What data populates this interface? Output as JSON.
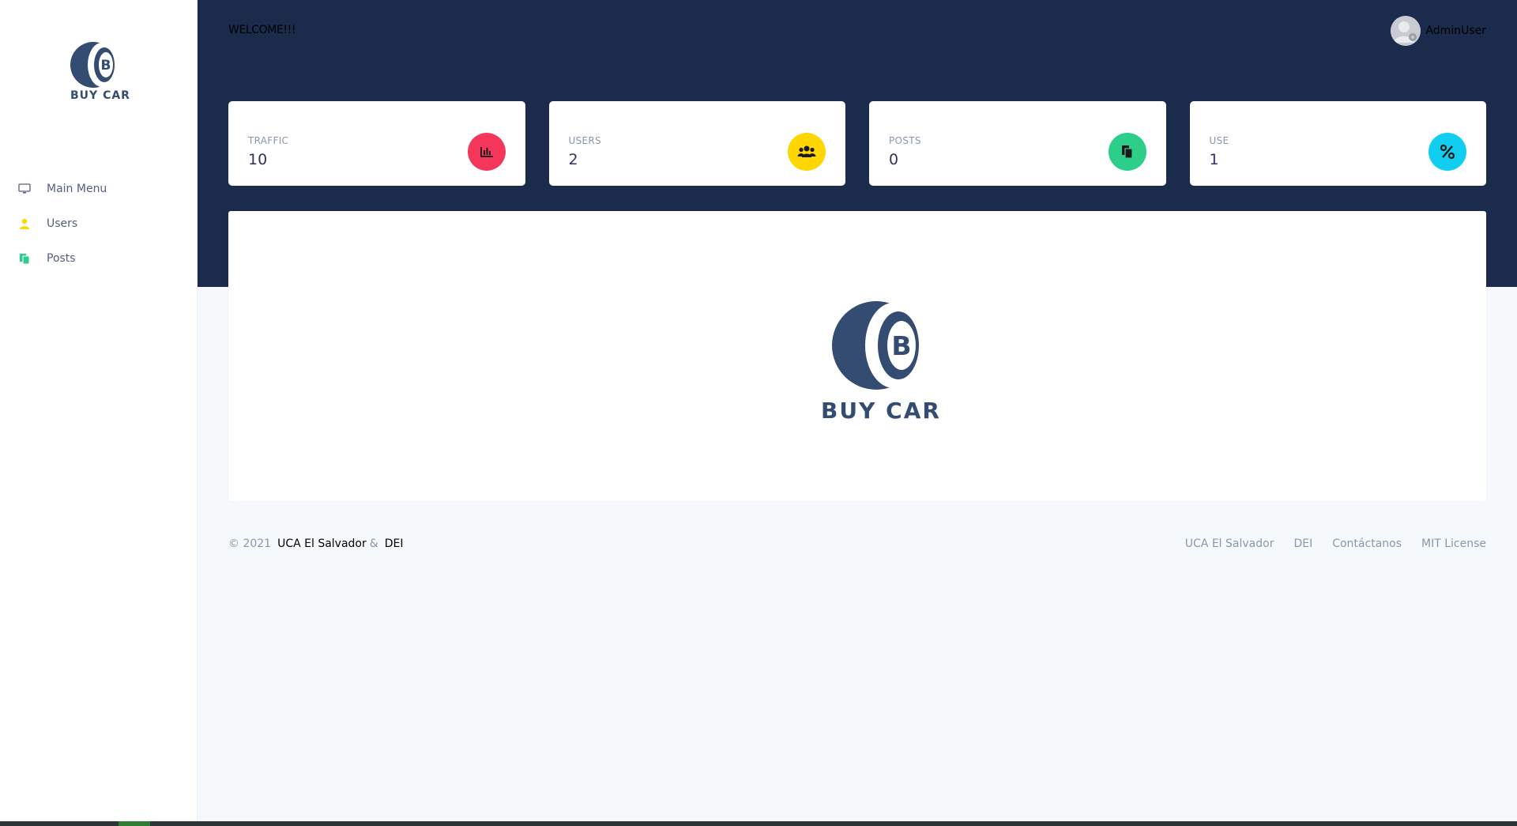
{
  "brand": {
    "name": "BUY CAR",
    "letter": "B",
    "color": "#344b72"
  },
  "sidebar": {
    "items": [
      {
        "label": "Main Menu",
        "icon": "monitor-icon",
        "color": "#525f7f"
      },
      {
        "label": "Users",
        "icon": "user-icon",
        "color": "#ffd600"
      },
      {
        "label": "Posts",
        "icon": "copy-icon",
        "color": "#2dce89"
      }
    ]
  },
  "header": {
    "welcome": "WELCOME!!!",
    "username": "AdminUser",
    "background": "#1a2b4c"
  },
  "cards": [
    {
      "title": "TRAFFIC",
      "value": "10",
      "icon": "chart-bar-icon",
      "color": "#f5365c"
    },
    {
      "title": "USERS",
      "value": "2",
      "icon": "users-icon",
      "color": "#ffd600"
    },
    {
      "title": "POSTS",
      "value": "0",
      "icon": "copy-icon",
      "color": "#2dce89"
    },
    {
      "title": "USE",
      "value": "1",
      "icon": "percent-icon",
      "color": "#11cdef"
    }
  ],
  "footer": {
    "copyright": "© 2021",
    "org": "UCA El Salvador",
    "amp": "&",
    "dept": "DEI",
    "links": [
      "UCA El Salvador",
      "DEI",
      "Contáctanos",
      "MIT License"
    ]
  }
}
